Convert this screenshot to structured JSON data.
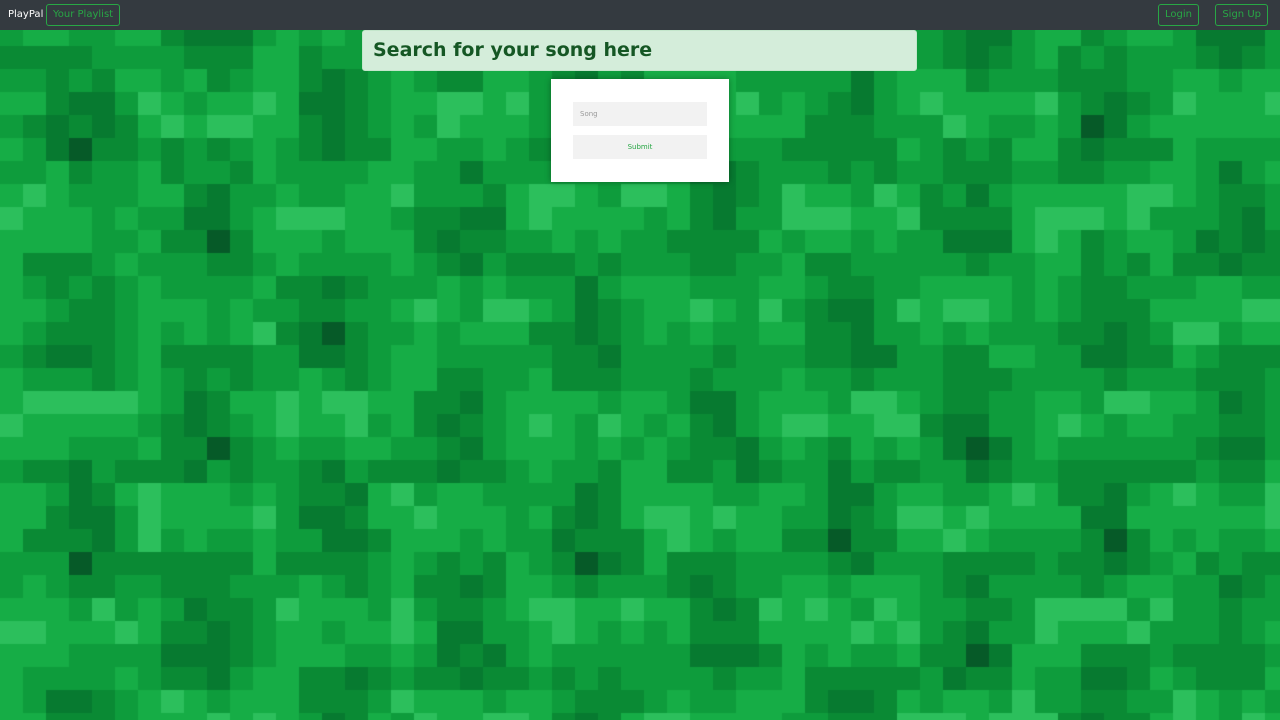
{
  "app": {
    "brand": "PlayPal"
  },
  "navbar": {
    "your_playlist_label": "Your Playlist",
    "login_label": "Login",
    "signup_label": "Sign Up"
  },
  "search": {
    "banner_text": "Search for your song here",
    "song_placeholder": "Song",
    "song_value": "",
    "submit_label": "Submit"
  },
  "colors": {
    "navbar_bg": "#343a40",
    "accent_green": "#28a745",
    "banner_bg": "#d4edda",
    "banner_text": "#155724",
    "background_palette": [
      "#065a28",
      "#077a30",
      "#0a8a34",
      "#0e9c3c",
      "#16ad46",
      "#2cbf5c",
      "#46d27a"
    ]
  }
}
